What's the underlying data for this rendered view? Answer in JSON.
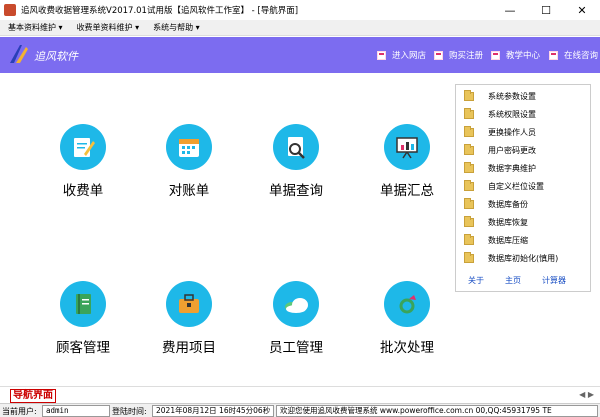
{
  "window": {
    "title": "追风收费收据管理系统V2017.01试用版【追风软件工作室】 - [导航界面]",
    "minimize": "—",
    "maximize": "☐",
    "close": "✕"
  },
  "menu": [
    "基本资料维护 ▾",
    "收费单资料维护 ▾",
    "系统与帮助 ▾"
  ],
  "banner": {
    "brand": "追风软件",
    "links": [
      "进入网店",
      "购买注册",
      "教学中心",
      "在线咨询"
    ]
  },
  "tiles": [
    {
      "label": "收费单",
      "icon": "edit-document-icon"
    },
    {
      "label": "对账单",
      "icon": "calendar-icon"
    },
    {
      "label": "单据查询",
      "icon": "search-document-icon"
    },
    {
      "label": "单据汇总",
      "icon": "presentation-chart-icon"
    },
    {
      "label": "顾客管理",
      "icon": "address-book-icon"
    },
    {
      "label": "费用项目",
      "icon": "briefcase-icon"
    },
    {
      "label": "员工管理",
      "icon": "cloud-icon"
    },
    {
      "label": "批次处理",
      "icon": "ring-icon"
    }
  ],
  "side_panel": {
    "items": [
      "系统参数设置",
      "系统权限设置",
      "更换操作人员",
      "用户密码更改",
      "数据字典维护",
      "自定义栏位设置",
      "数据库备份",
      "数据库恢复",
      "数据库压缩",
      "数据库初始化(慎用)"
    ],
    "links": [
      "关于",
      "主页",
      "计算器"
    ]
  },
  "tab": {
    "label": "导航界面",
    "arrows": "◀ ▶"
  },
  "status": {
    "user_label": "当前用户:",
    "user_value": "admin",
    "login_label": "登陆时间:",
    "login_value": "2021年08月12日 16时45分06秒",
    "message": "欢迎您使用追风收费管理系统 www.poweroffice.com.cn 00,QQ:45931795 TE"
  },
  "colors": {
    "banner": "#7c6cf0",
    "icon_circle": "#1eb8e8",
    "tab_red": "#cc0000",
    "link_blue": "#1a4fc4"
  }
}
